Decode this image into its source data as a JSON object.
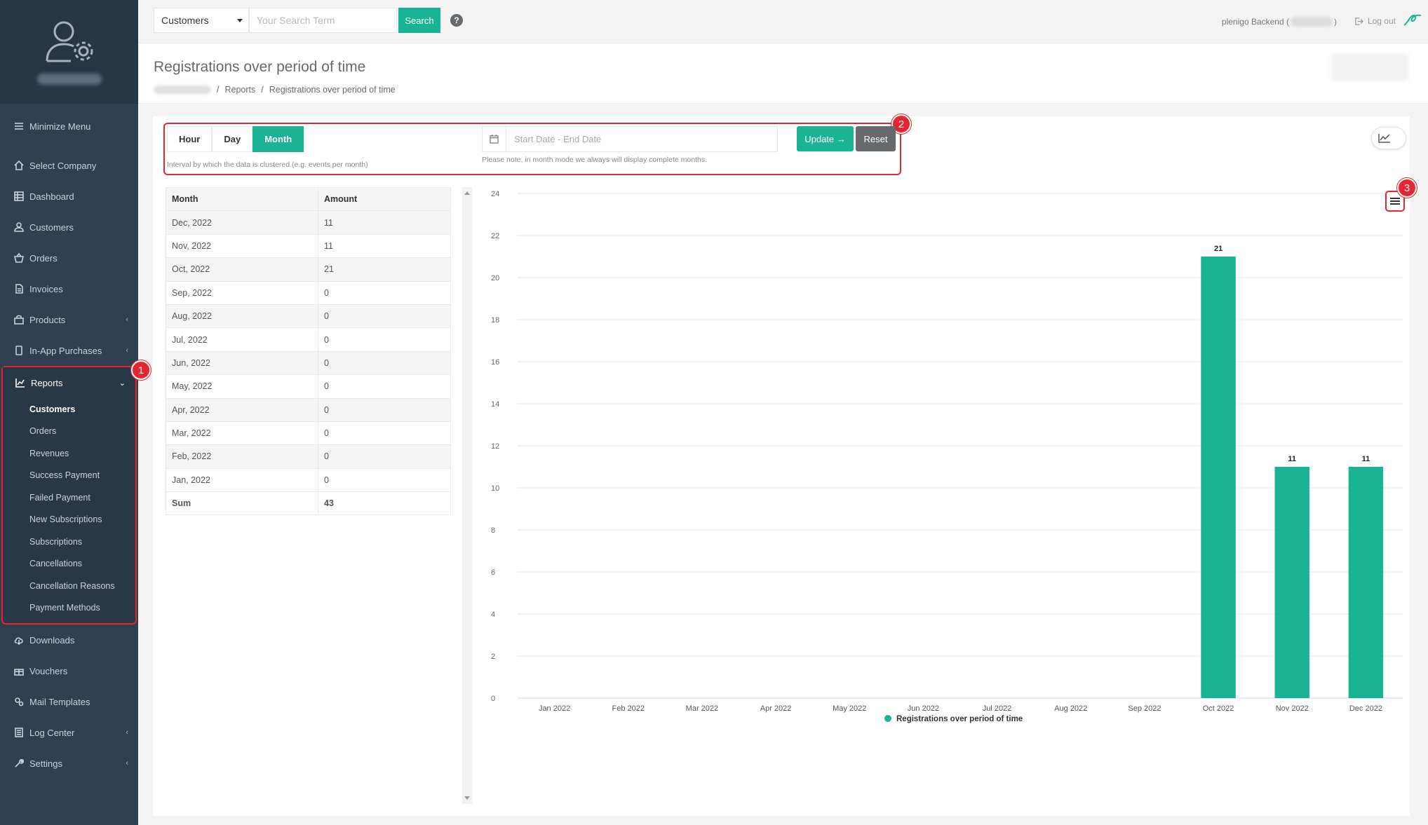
{
  "sidebar": {
    "minimize": "Minimize Menu",
    "items_top": [
      {
        "label": "Select Company",
        "icon": "home-icon"
      },
      {
        "label": "Dashboard",
        "icon": "grid-icon"
      },
      {
        "label": "Customers",
        "icon": "user-icon"
      },
      {
        "label": "Orders",
        "icon": "basket-icon"
      },
      {
        "label": "Invoices",
        "icon": "file-icon"
      },
      {
        "label": "Products",
        "icon": "bag-icon"
      },
      {
        "label": "In-App Purchases",
        "icon": "phone-icon"
      }
    ],
    "reports": {
      "label": "Reports",
      "sub": [
        "Customers",
        "Orders",
        "Revenues",
        "Success Payment",
        "Failed Payment",
        "New Subscriptions",
        "Subscriptions",
        "Cancellations",
        "Cancellation Reasons",
        "Payment Methods"
      ]
    },
    "items_bottom": [
      {
        "label": "Downloads"
      },
      {
        "label": "Vouchers"
      },
      {
        "label": "Mail Templates"
      },
      {
        "label": "Log Center"
      },
      {
        "label": "Settings"
      }
    ]
  },
  "topbar": {
    "search_category": "Customers",
    "search_placeholder": "Your Search Term",
    "search_button": "Search",
    "help": "?",
    "user_label": "plenigo Backend (",
    "user_label_end": ")",
    "logout": "Log out"
  },
  "heading": {
    "title": "Registrations over period of time",
    "breadcrumb_reports": "Reports",
    "breadcrumb_current": "Registrations over period of time",
    "sep": "/"
  },
  "controls": {
    "interval_buttons": [
      "Hour",
      "Day",
      "Month"
    ],
    "active_interval": "Month",
    "interval_help": "Interval by which the data is clustered (e.g. events per month)",
    "date_placeholder": "Start Date - End Date",
    "date_help": "Please note, in month mode we always will display complete months.",
    "update": "Update →",
    "reset": "Reset"
  },
  "markers": [
    "1",
    "2",
    "3"
  ],
  "table": {
    "headers": [
      "Month",
      "Amount"
    ],
    "rows": [
      [
        "Dec, 2022",
        "11"
      ],
      [
        "Nov, 2022",
        "11"
      ],
      [
        "Oct, 2022",
        "21"
      ],
      [
        "Sep, 2022",
        "0"
      ],
      [
        "Aug, 2022",
        "0"
      ],
      [
        "Jul, 2022",
        "0"
      ],
      [
        "Jun, 2022",
        "0"
      ],
      [
        "May, 2022",
        "0"
      ],
      [
        "Apr, 2022",
        "0"
      ],
      [
        "Mar, 2022",
        "0"
      ],
      [
        "Feb, 2022",
        "0"
      ],
      [
        "Jan, 2022",
        "0"
      ]
    ],
    "sum_label": "Sum",
    "sum_value": "43"
  },
  "chart_data": {
    "type": "bar",
    "categories": [
      "Jan 2022",
      "Feb 2022",
      "Mar 2022",
      "Apr 2022",
      "May 2022",
      "Jun 2022",
      "Jul 2022",
      "Aug 2022",
      "Sep 2022",
      "Oct 2022",
      "Nov 2022",
      "Dec 2022"
    ],
    "series": [
      {
        "name": "Registrations over period of time",
        "values": [
          0,
          0,
          0,
          0,
          0,
          0,
          0,
          0,
          0,
          21,
          11,
          11
        ]
      }
    ],
    "ylim": [
      0,
      24
    ],
    "yticks": [
      0,
      2,
      4,
      6,
      8,
      10,
      12,
      14,
      16,
      18,
      20,
      22,
      24
    ],
    "data_labels": true,
    "legend": "bottom",
    "grid": true,
    "color": "#1ab394"
  }
}
